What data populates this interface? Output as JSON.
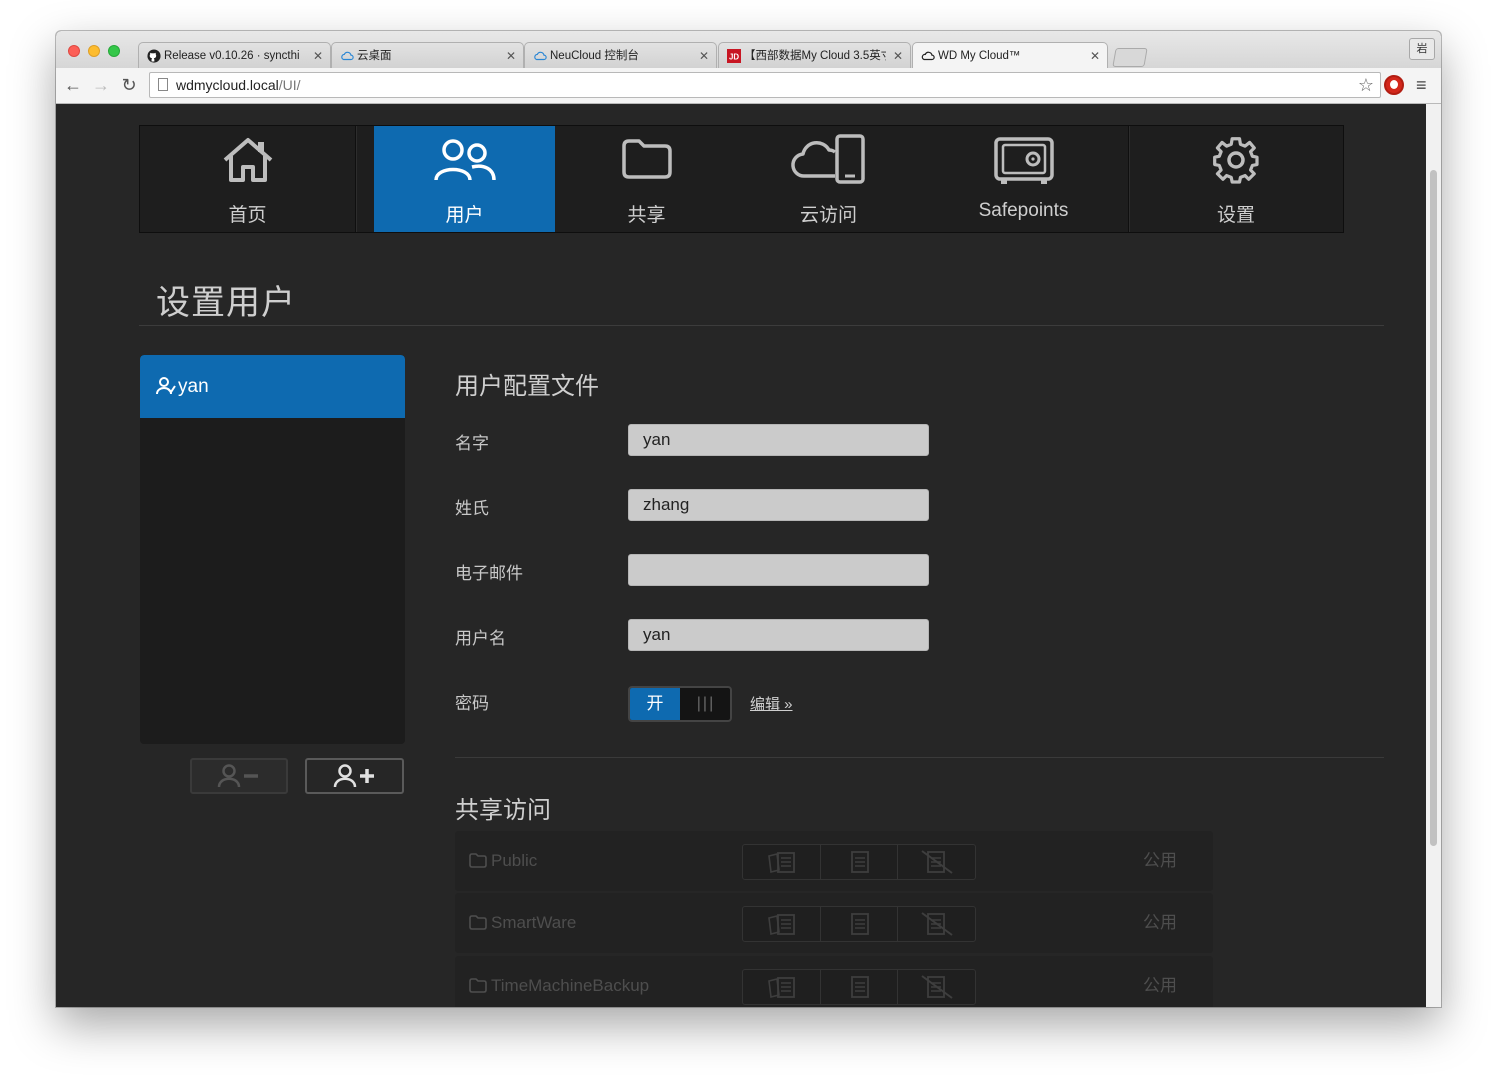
{
  "browser": {
    "tabs": [
      {
        "title": "Release v0.10.26 · syncthi",
        "icon": "github-icon"
      },
      {
        "title": "云桌面",
        "icon": "cloud-icon"
      },
      {
        "title": "NeuCloud 控制台",
        "icon": "cloud-icon"
      },
      {
        "title": "【西部数据My Cloud 3.5英寸",
        "icon": "jd-icon"
      },
      {
        "title": "WD My Cloud™",
        "icon": "wd-cloud-icon",
        "active": true
      }
    ],
    "profile_label": "岩",
    "url_host": "wdmycloud.local",
    "url_path": "/UI/"
  },
  "nav": {
    "items": [
      {
        "label": "首页",
        "icon": "home-icon"
      },
      {
        "label": "用户",
        "icon": "users-icon",
        "active": true
      },
      {
        "label": "共享",
        "icon": "folder-icon"
      },
      {
        "label": "云访问",
        "icon": "cloud-device-icon"
      },
      {
        "label": "Safepoints",
        "icon": "safe-icon"
      },
      {
        "label": "设置",
        "icon": "gear-icon"
      }
    ]
  },
  "page": {
    "title": "设置用户"
  },
  "users": {
    "list": [
      {
        "name": "yan",
        "selected": true
      }
    ]
  },
  "profile": {
    "section_title": "用户配置文件",
    "first_name_label": "名字",
    "first_name_value": "yan",
    "last_name_label": "姓氏",
    "last_name_value": "zhang",
    "email_label": "电子邮件",
    "email_value": "",
    "username_label": "用户名",
    "username_value": "yan",
    "password_label": "密码",
    "password_toggle_on": "开",
    "password_toggle_grip": "|||",
    "edit_link": "编辑 »"
  },
  "share_access": {
    "section_title": "共享访问",
    "shares": [
      {
        "name": "Public",
        "access": "公用"
      },
      {
        "name": "SmartWare",
        "access": "公用"
      },
      {
        "name": "TimeMachineBackup",
        "access": "公用"
      }
    ]
  },
  "colors": {
    "accent": "#0e6ab0",
    "background": "#262626",
    "input_bg": "#cbcbcb"
  }
}
